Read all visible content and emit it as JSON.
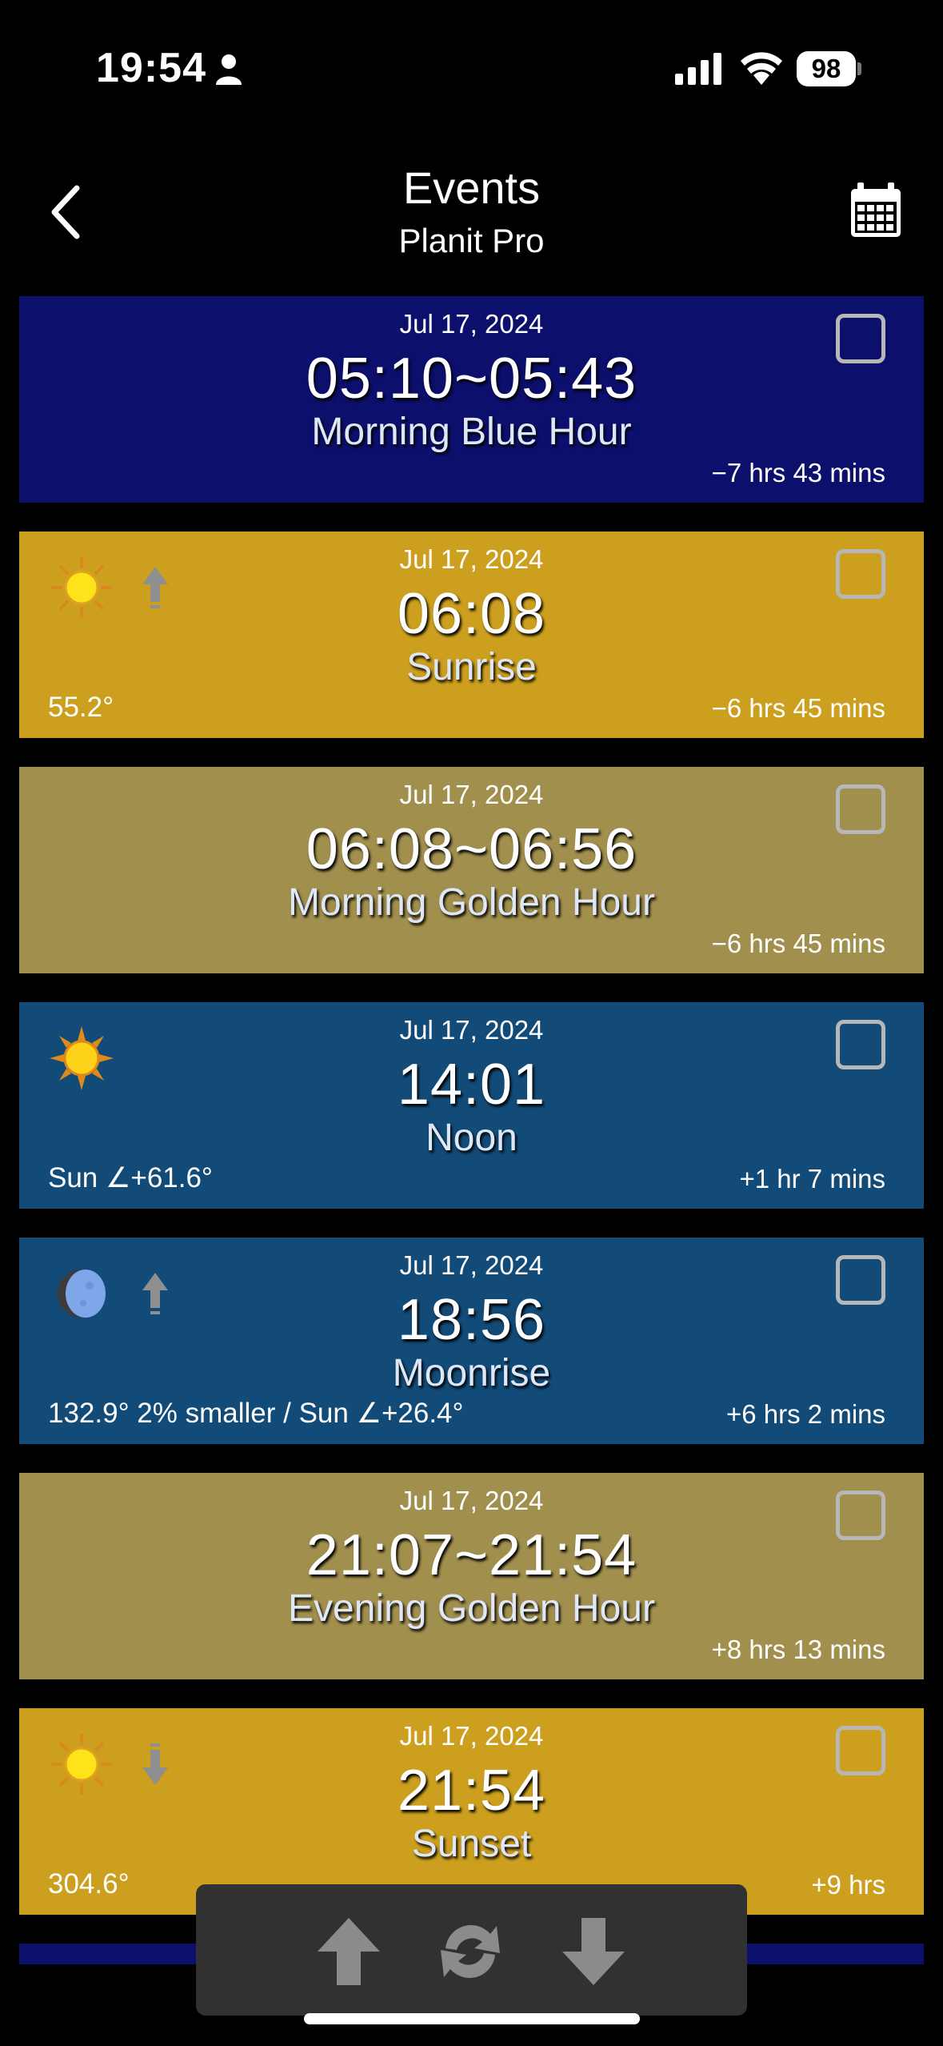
{
  "status_bar": {
    "time": "19:54",
    "battery": "98"
  },
  "header": {
    "title": "Events",
    "subtitle": "Planit Pro"
  },
  "colors": {
    "blue_hour": "#0c0f6b",
    "sun_event": "#cc9f1f",
    "golden_hour": "#a18f4d",
    "day": "#124b78",
    "toolbar": "#313131"
  },
  "events": [
    {
      "date": "Jul 17, 2024",
      "time": "05:10~05:43",
      "name": "Morning Blue Hour",
      "left_info": "",
      "right_info": "−7 hrs 43 mins",
      "icon": "",
      "arrow": ""
    },
    {
      "date": "Jul 17, 2024",
      "time": "06:08",
      "name": "Sunrise",
      "left_info": "55.2°",
      "right_info": "−6 hrs 45 mins",
      "icon": "sun-icon",
      "arrow": "up-arrow-icon"
    },
    {
      "date": "Jul 17, 2024",
      "time": "06:08~06:56",
      "name": "Morning Golden Hour",
      "left_info": "",
      "right_info": "−6 hrs 45 mins",
      "icon": "",
      "arrow": ""
    },
    {
      "date": "Jul 17, 2024",
      "time": "14:01",
      "name": "Noon",
      "left_info": "Sun ∠+61.6°",
      "right_info": "+1 hr 7 mins",
      "icon": "sun-icon",
      "arrow": ""
    },
    {
      "date": "Jul 17, 2024",
      "time": "18:56",
      "name": "Moonrise",
      "left_info": "132.9° 2% smaller / Sun ∠+26.4°",
      "right_info": "+6 hrs 2 mins",
      "icon": "moon-icon",
      "arrow": "up-arrow-icon"
    },
    {
      "date": "Jul 17, 2024",
      "time": "21:07~21:54",
      "name": "Evening Golden Hour",
      "left_info": "",
      "right_info": "+8 hrs 13 mins",
      "icon": "",
      "arrow": ""
    },
    {
      "date": "Jul 17, 2024",
      "time": "21:54",
      "name": "Sunset",
      "left_info": "304.6°",
      "right_info": "+9 hrs",
      "icon": "sun-icon",
      "arrow": "down-arrow-icon"
    }
  ],
  "toolbar": {
    "buttons": [
      "scroll-up",
      "refresh",
      "scroll-down"
    ]
  }
}
